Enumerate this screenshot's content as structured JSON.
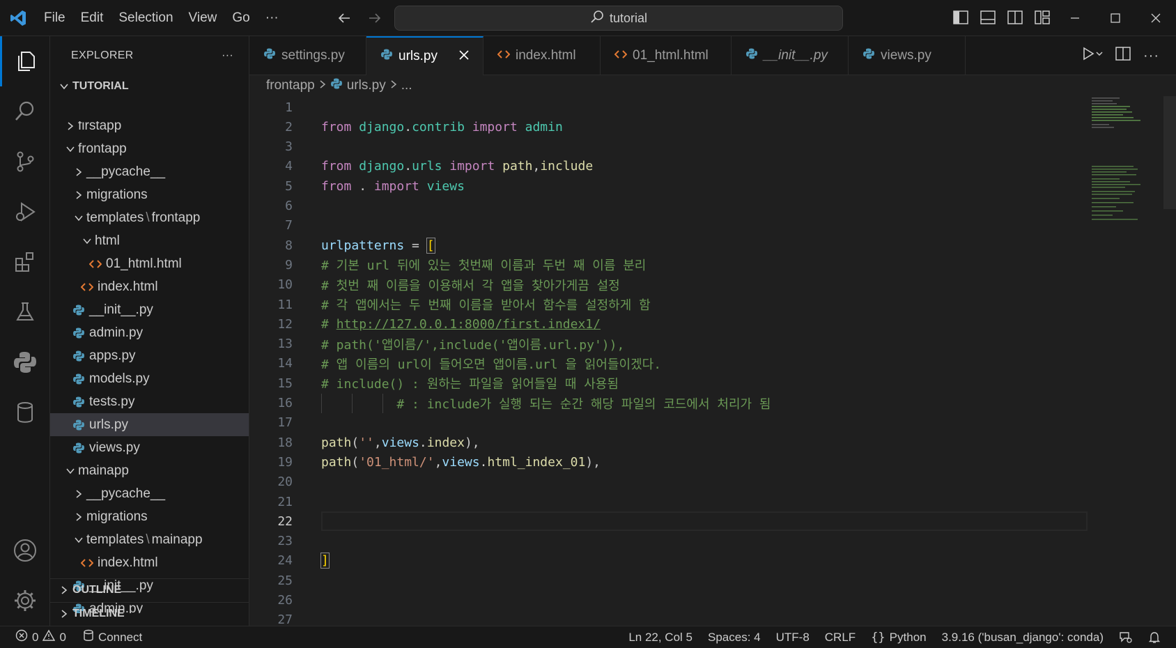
{
  "menu": [
    "File",
    "Edit",
    "Selection",
    "View",
    "Go",
    "···"
  ],
  "search": {
    "text": "tutorial"
  },
  "explorer": {
    "title": "EXPLORER",
    "more": "···",
    "root": "TUTORIAL",
    "items": [
      {
        "label": "firstapp",
        "indent": 1,
        "type": "folder",
        "open": false
      },
      {
        "label": "frontapp",
        "indent": 1,
        "type": "folder",
        "open": true
      },
      {
        "label": "__pycache__",
        "indent": 2,
        "type": "folder",
        "open": false
      },
      {
        "label": "migrations",
        "indent": 2,
        "type": "folder",
        "open": false
      },
      {
        "label": "templates",
        "label2": "frontapp",
        "indent": 2,
        "type": "folder",
        "open": true
      },
      {
        "label": "html",
        "indent": 3,
        "type": "folder",
        "open": true
      },
      {
        "label": "01_html.html",
        "indent": 4,
        "type": "html"
      },
      {
        "label": "index.html",
        "indent": 3,
        "type": "html"
      },
      {
        "label": "__init__.py",
        "indent": 2,
        "type": "py"
      },
      {
        "label": "admin.py",
        "indent": 2,
        "type": "py"
      },
      {
        "label": "apps.py",
        "indent": 2,
        "type": "py"
      },
      {
        "label": "models.py",
        "indent": 2,
        "type": "py"
      },
      {
        "label": "tests.py",
        "indent": 2,
        "type": "py"
      },
      {
        "label": "urls.py",
        "indent": 2,
        "type": "py",
        "selected": true
      },
      {
        "label": "views.py",
        "indent": 2,
        "type": "py"
      },
      {
        "label": "mainapp",
        "indent": 1,
        "type": "folder",
        "open": true
      },
      {
        "label": "__pycache__",
        "indent": 2,
        "type": "folder",
        "open": false
      },
      {
        "label": "migrations",
        "indent": 2,
        "type": "folder",
        "open": false
      },
      {
        "label": "templates",
        "label2": "mainapp",
        "indent": 2,
        "type": "folder",
        "open": true
      },
      {
        "label": "index.html",
        "indent": 3,
        "type": "html"
      },
      {
        "label": "__init__.py",
        "indent": 2,
        "type": "py"
      },
      {
        "label": "admin.py",
        "indent": 2,
        "type": "py"
      }
    ],
    "outline": "OUTLINE",
    "timeline": "TIMELINE"
  },
  "tabs": [
    {
      "label": "settings.py",
      "type": "py"
    },
    {
      "label": "urls.py",
      "type": "py",
      "active": true
    },
    {
      "label": "index.html",
      "type": "html"
    },
    {
      "label": "01_html.html",
      "type": "html"
    },
    {
      "label": "__init__.py",
      "type": "py",
      "italic": true
    },
    {
      "label": "views.py",
      "type": "py"
    }
  ],
  "breadcrumb": {
    "folder": "frontapp",
    "file": "urls.py",
    "rest": "..."
  },
  "editor": {
    "current_line": 22,
    "lines": [
      [],
      [
        [
          "kw",
          "from "
        ],
        [
          "mod",
          "django"
        ],
        [
          "pl",
          "."
        ],
        [
          "mod",
          "contrib"
        ],
        [
          "kw",
          " import "
        ],
        [
          "mod",
          "admin"
        ]
      ],
      [],
      [
        [
          "kw",
          "from "
        ],
        [
          "mod",
          "django"
        ],
        [
          "pl",
          "."
        ],
        [
          "mod",
          "urls"
        ],
        [
          "kw",
          " import "
        ],
        [
          "fn",
          "path"
        ],
        [
          "pl",
          ","
        ],
        [
          "fn",
          "include"
        ]
      ],
      [
        [
          "kw",
          "from "
        ],
        [
          "pl",
          ". "
        ],
        [
          "kw",
          "import "
        ],
        [
          "mod",
          "views"
        ]
      ],
      [],
      [],
      [
        [
          "id",
          "urlpatterns"
        ],
        [
          "pl",
          " = "
        ],
        [
          "brb",
          "["
        ]
      ],
      [
        [
          "cm",
          "# 기본 url 뒤에 있는 첫번째 이름과 두번 째 이름 분리"
        ]
      ],
      [
        [
          "cm",
          "# 첫번 째 이름을 이용해서 각 앱을 찾아가게끔 설정"
        ]
      ],
      [
        [
          "cm",
          "# 각 앱에서는 두 번째 이름을 받아서 함수를 설정하게 함"
        ]
      ],
      [
        [
          "cm",
          "# "
        ],
        [
          "link",
          "http://127.0.0.1:8000/first.index1/"
        ]
      ],
      [
        [
          "cm",
          "# path('앱이름/',include('앱이름.url.py')),"
        ]
      ],
      [
        [
          "cm",
          "# 앱 이름의 url이 들어오면 앱이름.url 을 읽어들이겠다."
        ]
      ],
      [
        [
          "cm",
          "# include() : 원하는 파일을 읽어들일 때 사용됨"
        ]
      ],
      [
        [
          "cm",
          "          # : include가 실행 되는 순간 해당 파일의 코드에서 처리가 됨"
        ]
      ],
      [],
      [
        [
          "fn",
          "path"
        ],
        [
          "pl",
          "("
        ],
        [
          "str",
          "''"
        ],
        [
          "pl",
          ","
        ],
        [
          "id",
          "views"
        ],
        [
          "pl",
          "."
        ],
        [
          "fn",
          "index"
        ],
        [
          "pl",
          "),"
        ]
      ],
      [
        [
          "fn",
          "path"
        ],
        [
          "pl",
          "("
        ],
        [
          "str",
          "'01_html/'"
        ],
        [
          "pl",
          ","
        ],
        [
          "id",
          "views"
        ],
        [
          "pl",
          "."
        ],
        [
          "fn",
          "html_index_01"
        ],
        [
          "pl",
          "),"
        ]
      ],
      [],
      [],
      [],
      [],
      [
        [
          "brb",
          "]"
        ]
      ],
      [],
      [],
      []
    ]
  },
  "status": {
    "errors": "0",
    "warnings": "0",
    "connect": "Connect",
    "position": "Ln 22, Col 5",
    "spaces": "Spaces: 4",
    "encoding": "UTF-8",
    "eol": "CRLF",
    "language": "Python",
    "interpreter": "3.9.16 ('busan_django': conda)"
  },
  "colors": {
    "accent": "#0078d4",
    "python_icon": "#519aba",
    "html_icon": "#e37933"
  }
}
